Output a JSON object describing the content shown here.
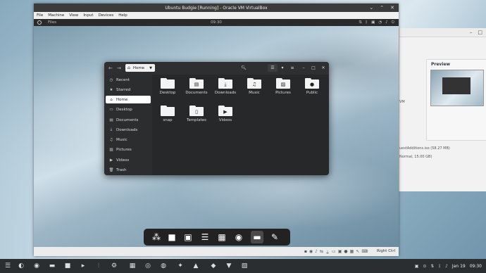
{
  "host": {
    "bg_window": {
      "preview_label": "Preview",
      "text_1": "VM",
      "text_2": "uestAdditions.iso (58.27 MB)",
      "text_3": "Normal, 15.00 GB)"
    },
    "panel": {
      "date": "Jan 19",
      "time": "09:30",
      "icons": [
        "budgie-menu-icon",
        "firefox-icon",
        "files-icon",
        "briefcase-icon",
        "terminal-icon",
        "chart-icon",
        "settings-icon",
        "image-viewer-icon",
        "steam-icon",
        "media-icon",
        "gimp-icon",
        "inkscape-icon",
        "transmission-icon",
        "vlc-icon",
        "image-app-icon",
        "app-icon"
      ]
    }
  },
  "vbox": {
    "title": "Ubuntu Budgie [Running] - Oracle VM VirtualBox",
    "menu": [
      "File",
      "Machine",
      "View",
      "Input",
      "Devices",
      "Help"
    ],
    "host_key": "Right Ctrl"
  },
  "guest": {
    "topbar": {
      "app": "Files",
      "clock": "09:30"
    },
    "files": {
      "path": "Home",
      "sidebar": [
        {
          "label": "Recent",
          "icon": "clock-icon"
        },
        {
          "label": "Starred",
          "icon": "star-icon"
        },
        {
          "label": "Home",
          "icon": "home-icon"
        },
        {
          "label": "Desktop",
          "icon": "desktop-icon"
        },
        {
          "label": "Documents",
          "icon": "document-icon"
        },
        {
          "label": "Downloads",
          "icon": "download-icon"
        },
        {
          "label": "Music",
          "icon": "music-icon"
        },
        {
          "label": "Pictures",
          "icon": "picture-icon"
        },
        {
          "label": "Videos",
          "icon": "video-icon"
        },
        {
          "label": "Trash",
          "icon": "trash-icon"
        }
      ],
      "items": [
        {
          "label": "Desktop"
        },
        {
          "label": "Documents"
        },
        {
          "label": "Downloads"
        },
        {
          "label": "Music"
        },
        {
          "label": "Pictures"
        },
        {
          "label": "Public"
        },
        {
          "label": "snap"
        },
        {
          "label": "Templates"
        },
        {
          "label": "Videos"
        }
      ]
    }
  }
}
